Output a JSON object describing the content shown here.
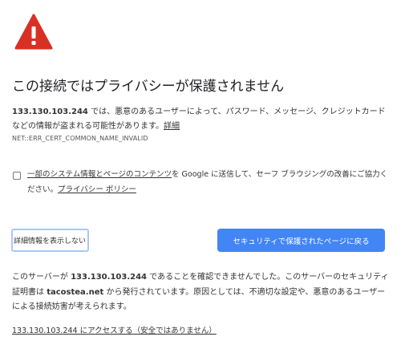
{
  "icon": "warning-triangle-icon",
  "colors": {
    "warning_red": "#d93025",
    "primary_blue": "#4285f4",
    "focus_ring": "#a8c7fa"
  },
  "title": "この接続ではプライバシーが保護されません",
  "description": {
    "host": "133.130.103.244",
    "text": " では、悪意のあるユーザーによって、パスワード、メッセージ、クレジットカードなどの情報が盗まれる可能性があります。",
    "details_link": "詳細"
  },
  "error_code": "NET::ERR_CERT_COMMON_NAME_INVALID",
  "report": {
    "link_text": "一部のシステム情報とページのコンテンツ",
    "text_after": "を Google に送信して、セーフ ブラウジングの改善にご協力ください。",
    "privacy_link": "プライバシー ポリシー"
  },
  "buttons": {
    "details": "詳細情報を表示しない",
    "back": "セキュリティで保護されたページに戻る"
  },
  "details": {
    "prefix": "このサーバーが ",
    "host": "133.130.103.244",
    "middle": " であることを確認できませんでした。このサーバーのセキュリティ証明書は ",
    "issuer": "tacostea.net",
    "suffix": " から発行されています。原因としては、不適切な設定や、悪意のあるユーザーによる接続妨害が考えられます。"
  },
  "proceed_link": "133.130.103.244 にアクセスする（安全ではありません）"
}
